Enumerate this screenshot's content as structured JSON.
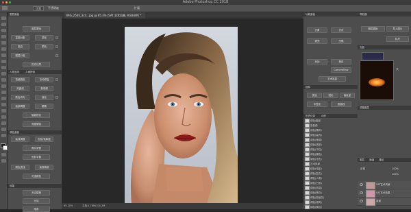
{
  "window": {
    "title": "Adobe Photoshop CC 2018"
  },
  "options_bar": {
    "mode_value": "正常",
    "opacity_label": "不透明度",
    "zoom_label": "扩展"
  },
  "document": {
    "tab_title": "IMG_2565_3c4...jpg @ 65.3% (SAT 艺术风景, RGB/8#) *",
    "zoom": "65.25%",
    "status_text": "文档:5.78M/100.3M"
  },
  "left_panel": {
    "header": "图层面板",
    "buttons_top": [
      "图层蒙版",
      "智能对象",
      "锐化",
      "描边",
      "颜色",
      "图层分组",
      "历史记录"
    ],
    "tab_a": "人物选项",
    "tab_b": "人像修饰",
    "buttons_mid": [
      "高级磨皮",
      "自动修复",
      "双曲线",
      "高低频",
      "肤色均匀",
      "液化",
      "面部调整",
      "眼睛",
      "智能锐化",
      "亮度蒙版"
    ],
    "section2": "调色面板",
    "buttons_low": [
      "曲线调整",
      "色相/饱和度",
      "照片滤镜",
      "色彩平衡",
      "颜色查找",
      "渐变映射",
      "可选颜色"
    ],
    "section3": "效果",
    "buttons_bottom": [
      "天空替换",
      "光效",
      "暗角"
    ]
  },
  "mid_panel": {
    "header": "功能面板",
    "buttons": [
      "去黄",
      "去灰",
      "提亮",
      "压暗",
      "对比",
      "美白",
      "CameraRaw",
      "艺术效果",
      "快速",
      "锐化",
      "高反差",
      "中性灰",
      "双曲线"
    ],
    "section2": "插件",
    "section3": "动作"
  },
  "right_panel": {
    "header": "导航器",
    "buttons": [
      "图层模板",
      "导入图片",
      "标尺"
    ],
    "tab": "色板",
    "label2": "大",
    "section2": "调整图层"
  },
  "actions_list": {
    "header_a": "历史记录",
    "header_b": "动作",
    "items": [
      "调色/磨皮",
      "高低频",
      "调色(柔和)",
      "调色(高亮)",
      "调色(暗调)",
      "调色(清新)",
      "调色(中性)",
      "调色(暖色)",
      "调色(冷色)",
      "艺术风景",
      "调色(电影)",
      "调色(复古)",
      "调色(人像)",
      "调色(日系)",
      "调色(质感)",
      "调色(黑白)",
      "调色(高级灰)",
      "调色(港风)",
      "调色(美妆)",
      "调色(通透)"
    ]
  },
  "layers": {
    "tabs": [
      "图层",
      "通道",
      "路径"
    ],
    "blend_mode": "正常",
    "opacity": "100%",
    "fill": "100%",
    "items": [
      {
        "name": "SAT艺术风景",
        "visible": true
      },
      {
        "name": "SAT艺术效果",
        "visible": true
      },
      {
        "name": "背景",
        "visible": true
      }
    ]
  },
  "colors": {
    "accent": "#f08020",
    "dark": "#282828"
  }
}
